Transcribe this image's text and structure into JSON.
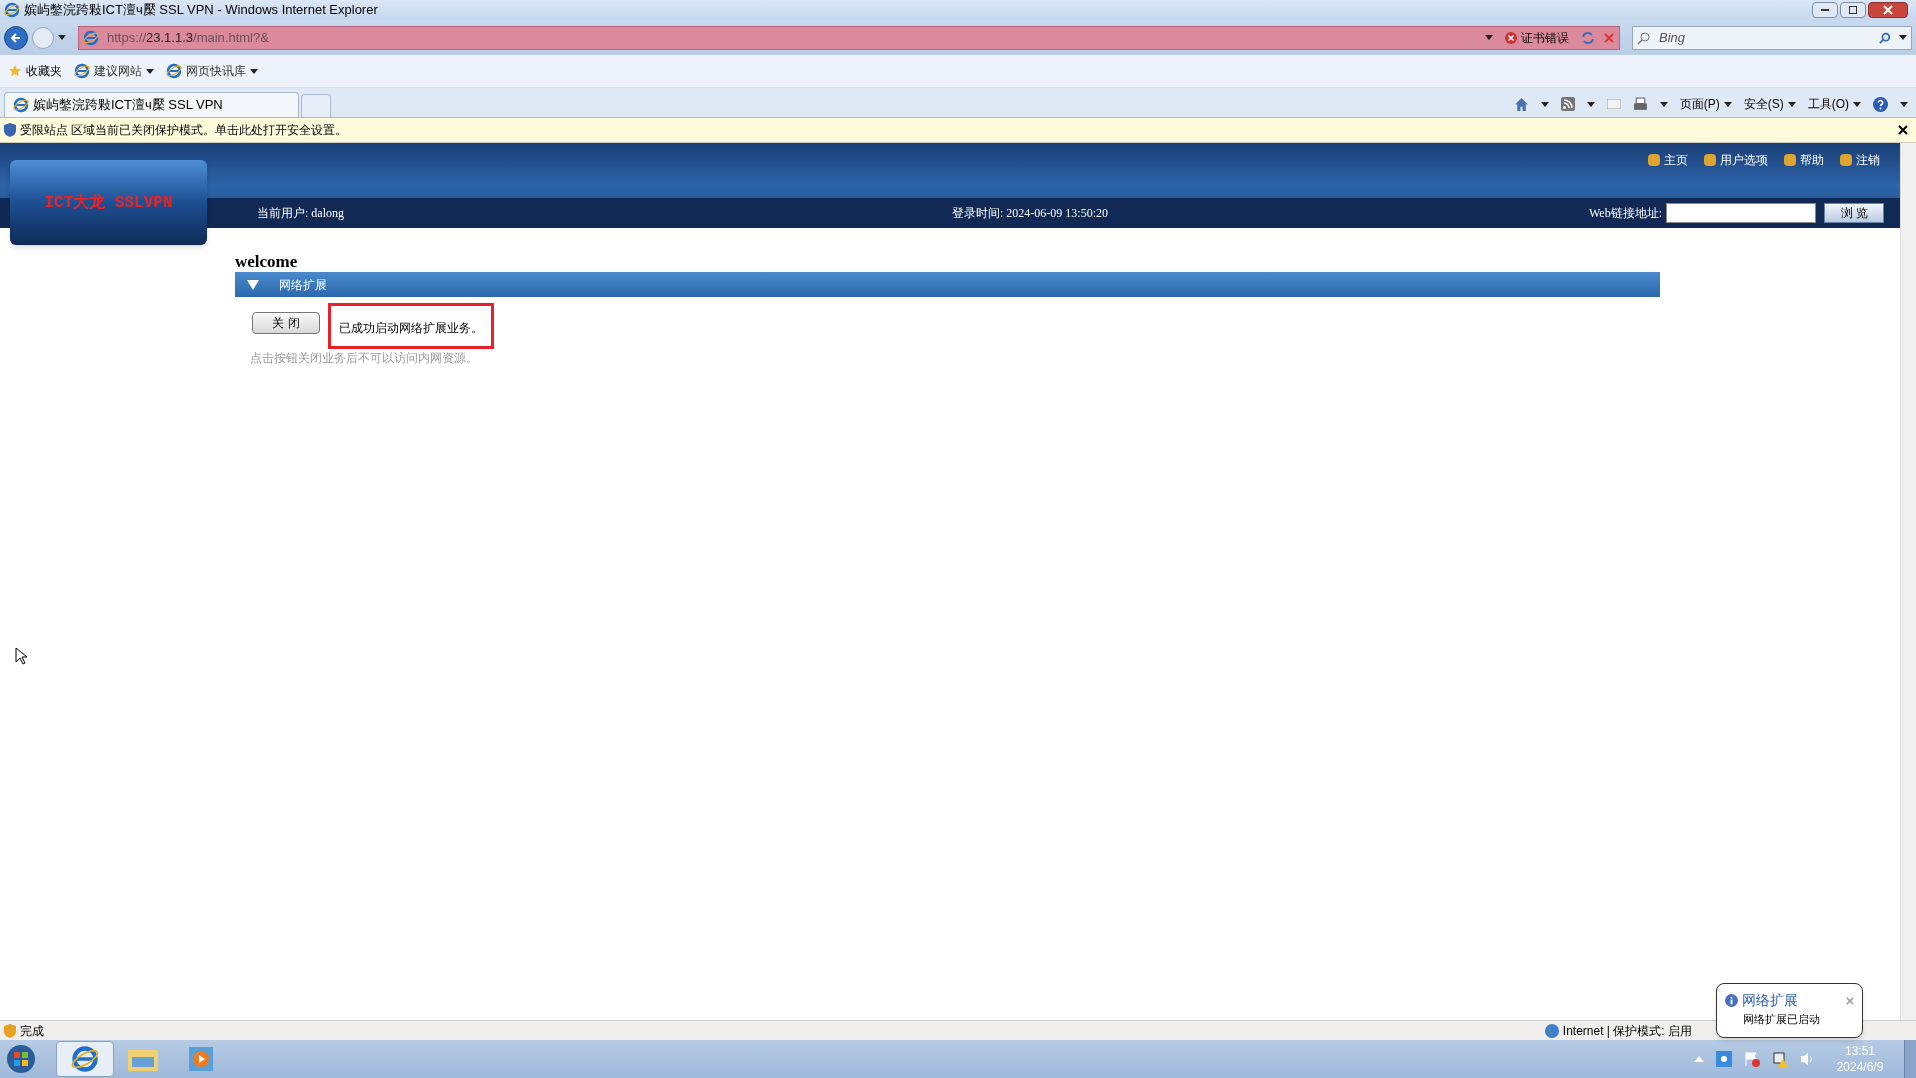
{
  "window": {
    "title": "嫔屿鐅浣跨敤ICT澶ч檿 SSL VPN - Windows Internet Explorer"
  },
  "address_bar": {
    "url_prefix": "https://",
    "url_host": "23.1.1.3",
    "url_path": "/main.html?&",
    "cert_error": "证书错误"
  },
  "search": {
    "placeholder": "Bing"
  },
  "favorites_bar": {
    "items": [
      "收藏夹",
      "建议网站",
      "网页快讯库"
    ]
  },
  "tabs": [
    {
      "label": "嫔屿鐅浣跨敤ICT澶ч檿 SSL VPN",
      "selected": true
    }
  ],
  "command_bar": {
    "items": [
      "页面(P)",
      "安全(S)",
      "工具(O)"
    ]
  },
  "info_bar": {
    "text": "受限站点 区域当前已关闭保护模式。单击此处打开安全设置。"
  },
  "header": {
    "logo": "ICT大龙 SSLVPN",
    "nav": [
      "主页",
      "用户选项",
      "帮助",
      "注销"
    ],
    "current_user": "当前用户: dalong",
    "login_time": "登录时间: 2024-06-09  13:50:20",
    "web_link_label": "Web链接地址:",
    "browse_button": "浏 览"
  },
  "content": {
    "heading": "welcome",
    "section_title": "网络扩展",
    "section_expanded": true,
    "close_button": "关 闭",
    "status_message": "已成功启动网络扩展业务。",
    "hint": "点击按钮关闭业务后不可以访问内网资源。"
  },
  "status_bar": {
    "text": "完成",
    "zone": "Internet | 保护模式: 启用"
  },
  "notification": {
    "title": "网络扩展",
    "body": "网络扩展已启动"
  },
  "taskbar": {
    "time": "13:51",
    "date": "2024/6/9"
  }
}
